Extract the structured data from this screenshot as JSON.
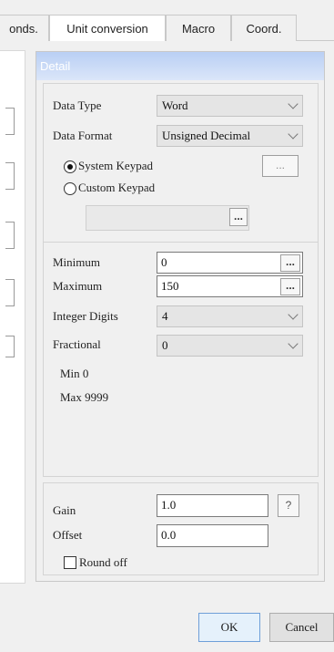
{
  "tabs": [
    "onds.",
    "Unit conversion",
    "Macro",
    "Coord."
  ],
  "detail": {
    "title": "Detail",
    "data_type_label": "Data Type",
    "data_type_value": "Word",
    "data_format_label": "Data Format",
    "data_format_value": "Unsigned Decimal",
    "system_keypad_label": "System Keypad",
    "custom_keypad_label": "Custom Keypad",
    "system_keypad_selected": true,
    "ellipsis": "...",
    "minimum_label": "Minimum",
    "minimum_value": "0",
    "maximum_label": "Maximum",
    "maximum_value": "150",
    "integer_digits_label": "Integer Digits",
    "integer_digits_value": "4",
    "fractional_label": "Fractional",
    "fractional_value": "0",
    "min_info": "Min 0",
    "max_info": "Max 9999",
    "gain_label": "Gain",
    "gain_value": "1.0",
    "help_label": "?",
    "offset_label": "Offset",
    "offset_value": "0.0",
    "round_off_label": "Round off",
    "round_off_checked": false
  },
  "footer": {
    "ok_label": "OK",
    "cancel_label": "Cancel"
  }
}
